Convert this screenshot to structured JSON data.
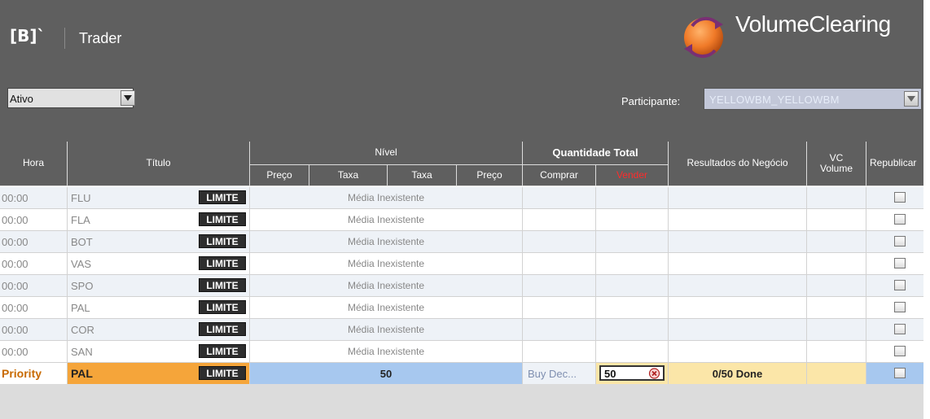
{
  "header": {
    "logo_text": "[B]`",
    "app_title": "Trader",
    "brand": "VolumeClearing"
  },
  "filters": {
    "ativo_value": "Ativo",
    "participante_label": "Participante:",
    "participante_value": "YELLOWBM_YELLOWBM"
  },
  "table": {
    "headers": {
      "hora": "Hora",
      "titulo": "Título",
      "nivel": "Nível",
      "preco1": "Preço",
      "taxa1": "Taxa",
      "taxa2": "Taxa",
      "preco2": "Preço",
      "quantidade_total": "Quantidade Total",
      "comprar": "Comprar",
      "vender": "Vender",
      "resultados": "Resultados do Negócio",
      "vc_volume_l1": "VC",
      "vc_volume_l2": "Volume",
      "republicar": "Republicar"
    },
    "limite_label": "LIMITE",
    "rows": [
      {
        "hora": "00:00",
        "titulo": "FLU",
        "nivel": "Média Inexistente"
      },
      {
        "hora": "00:00",
        "titulo": "FLA",
        "nivel": "Média Inexistente"
      },
      {
        "hora": "00:00",
        "titulo": "BOT",
        "nivel": "Média Inexistente"
      },
      {
        "hora": "00:00",
        "titulo": "VAS",
        "nivel": "Média Inexistente"
      },
      {
        "hora": "00:00",
        "titulo": "SPO",
        "nivel": "Média Inexistente"
      },
      {
        "hora": "00:00",
        "titulo": "PAL",
        "nivel": "Média Inexistente"
      },
      {
        "hora": "00:00",
        "titulo": "COR",
        "nivel": "Média Inexistente"
      },
      {
        "hora": "00:00",
        "titulo": "SAN",
        "nivel": "Média Inexistente"
      }
    ],
    "priority_row": {
      "hora": "Priority",
      "titulo": "PAL",
      "nivel": "50",
      "comprar": "Buy Dec...",
      "vender_input": "50",
      "resultado": "0/50 Done"
    }
  },
  "colors": {
    "bar": "#5f5f5f",
    "priority_orange": "#f5a53a",
    "priority_blue": "#a7c8ef",
    "priority_yellow": "#fbe6a8"
  }
}
